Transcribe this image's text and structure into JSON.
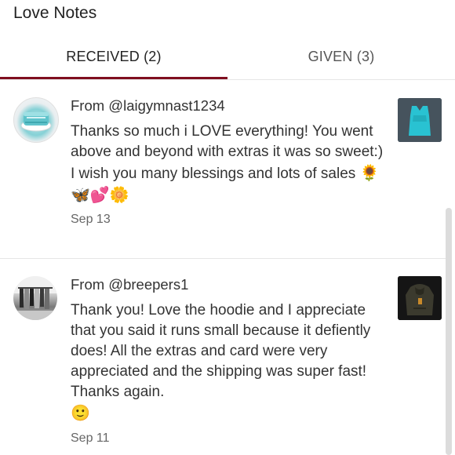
{
  "header": {
    "title": "Love Notes"
  },
  "tabs": [
    {
      "label": "RECEIVED (2)",
      "active": true
    },
    {
      "label": "GIVEN (3)",
      "active": false
    }
  ],
  "colors": {
    "accent": "#7f0e1f",
    "text": "#333333",
    "muted": "#666666"
  },
  "notes": [
    {
      "from": "From @laigymnast1234",
      "message": "Thanks so much i LOVE everything! You went above and beyond with extras it was so sweet:) I wish you many blessings and lots of sales ",
      "emojis": "🌻🦋💕🌼",
      "date": "Sep 13",
      "avatar_icon": "teal-cake-avatar-icon",
      "thumbnail_icon": "teal-top-thumbnail-icon"
    },
    {
      "from": "From @breepers1",
      "message": "Thank you! Love the hoodie and I appreciate that you said it runs small because it defiently does! All the extras and card were very appreciated and the shipping was super fast! Thanks again.",
      "emojis": "🙂",
      "date": "Sep 11",
      "avatar_icon": "clothing-rack-avatar-icon",
      "thumbnail_icon": "hoodie-thumbnail-icon"
    }
  ]
}
